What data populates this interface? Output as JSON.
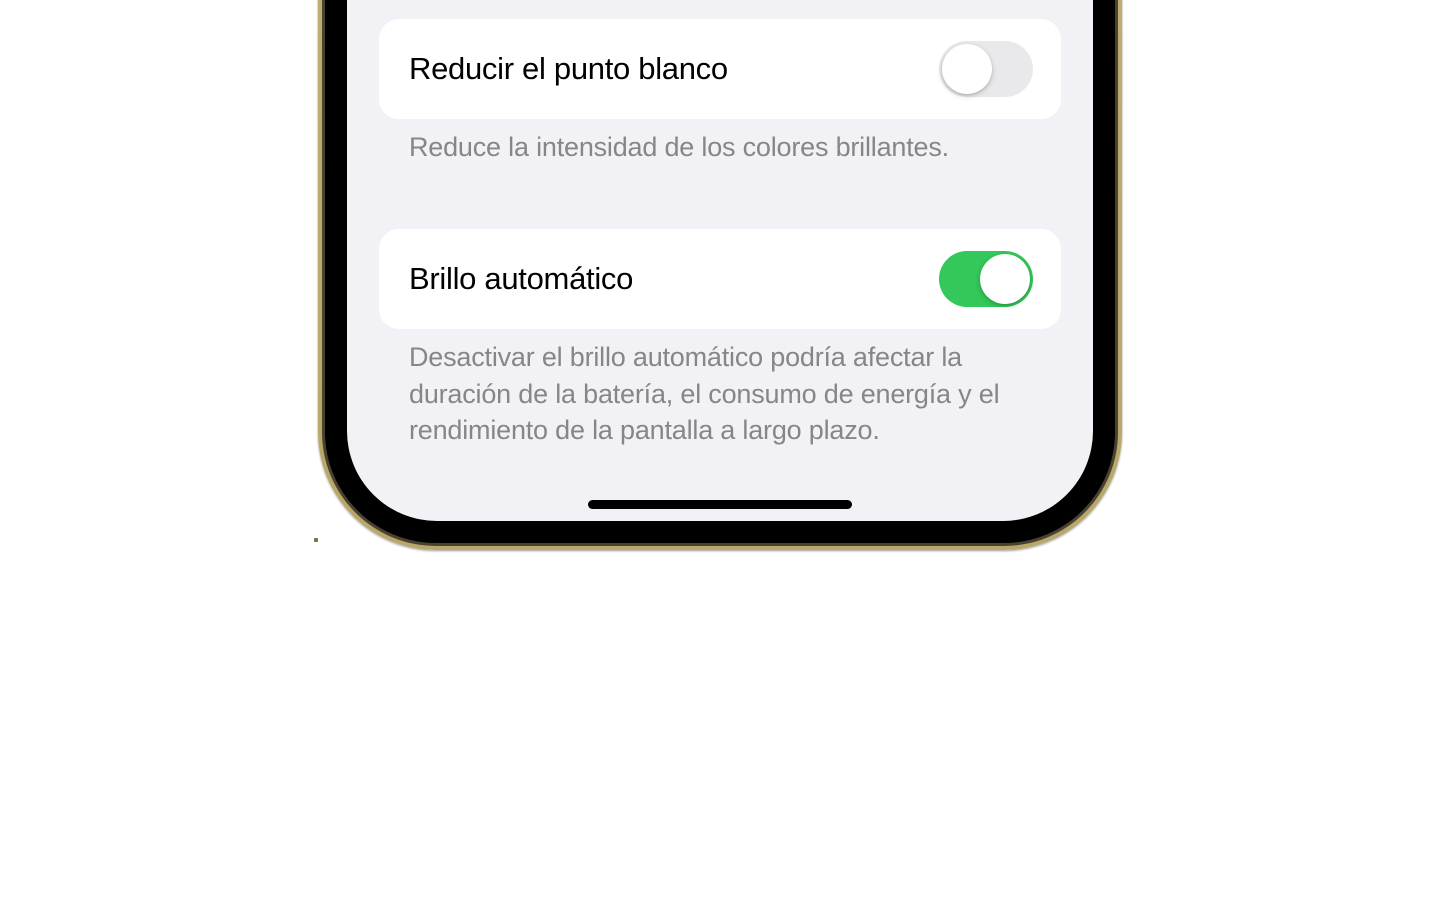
{
  "settings": {
    "reduceWhitePoint": {
      "label": "Reducir el punto blanco",
      "enabled": false,
      "description": "Reduce la intensidad de los colores brillantes."
    },
    "autoBrightness": {
      "label": "Brillo automático",
      "enabled": true,
      "description": "Desactivar el brillo automático podría afectar la duración de la batería, el consumo de energía y el rendimiento de la pantalla a largo plazo."
    }
  },
  "colors": {
    "toggleOn": "#34c759",
    "toggleOff": "#e9e9eb",
    "screenBg": "#f2f2f6",
    "rowBg": "#ffffff",
    "textPrimary": "#000000",
    "textSecondary": "#86868a"
  }
}
